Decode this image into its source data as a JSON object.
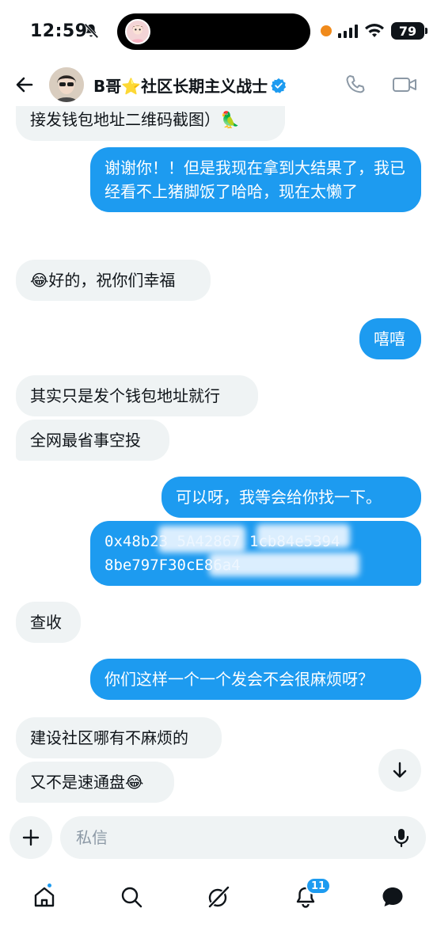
{
  "status_bar": {
    "time": "12:59",
    "battery": "79"
  },
  "header": {
    "name": "B哥⭐社区长期主义战士"
  },
  "messages": [
    {
      "side": "received",
      "text_line1": "…",
      "text_line2": "接发钱包地址二维码截图）🦜"
    },
    {
      "side": "sent",
      "text": "谢谢你！！但是我现在拿到大结果了，我已经看不上猪脚饭了哈哈，现在太懒了"
    },
    {
      "side": "received",
      "text": "😂好的，祝你们幸福"
    },
    {
      "side": "sent",
      "text": "嘻嘻"
    },
    {
      "side": "received",
      "text": "其实只是发个钱包地址就行"
    },
    {
      "side": "received",
      "text": "全网最省事空投"
    },
    {
      "side": "sent",
      "text": "可以呀，我等会给你找一下。"
    },
    {
      "side": "sent",
      "text_line1": "0x48b23 5A42867 1cb84e5394",
      "text_line2": "8be797F30cE86a4"
    },
    {
      "side": "received",
      "text": "查收"
    },
    {
      "side": "sent",
      "text": "你们这样一个一个发会不会很麻烦呀？"
    },
    {
      "side": "received",
      "text": "建设社区哪有不麻烦的"
    },
    {
      "side": "received",
      "text": "又不是速通盘😂"
    }
  ],
  "composer": {
    "placeholder": "私信"
  },
  "nav": {
    "notifications_count": "11"
  },
  "colors": {
    "accent": "#1d9bf0",
    "received_bubble": "#eff3f4"
  }
}
